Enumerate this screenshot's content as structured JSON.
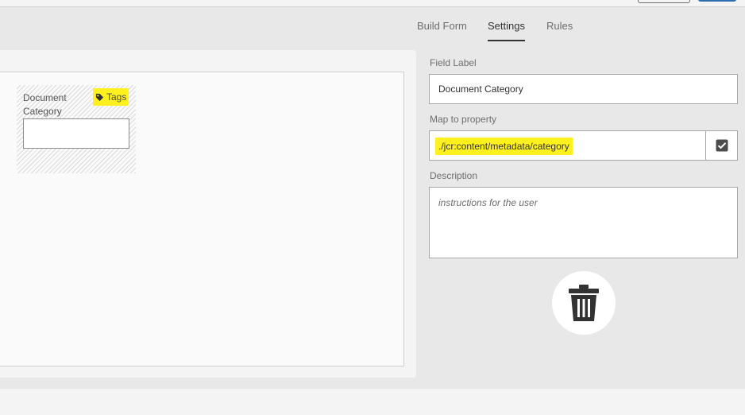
{
  "tabs": [
    {
      "label": "Build Form",
      "selected": false
    },
    {
      "label": "Settings",
      "selected": true
    },
    {
      "label": "Rules",
      "selected": false
    }
  ],
  "canvas": {
    "field": {
      "label": "Document Category",
      "badge_label": "Tags",
      "badge_icon": "tag-icon",
      "highlight_color": "#fff01e"
    }
  },
  "settings": {
    "field_label": {
      "label": "Field Label",
      "value": "Document Category"
    },
    "map_to_property": {
      "label": "Map to property",
      "value": "./jcr:content/metadata/category",
      "checked": true
    },
    "description": {
      "label": "Description",
      "placeholder": "instructions for the user"
    },
    "delete_icon": "trash-icon"
  }
}
